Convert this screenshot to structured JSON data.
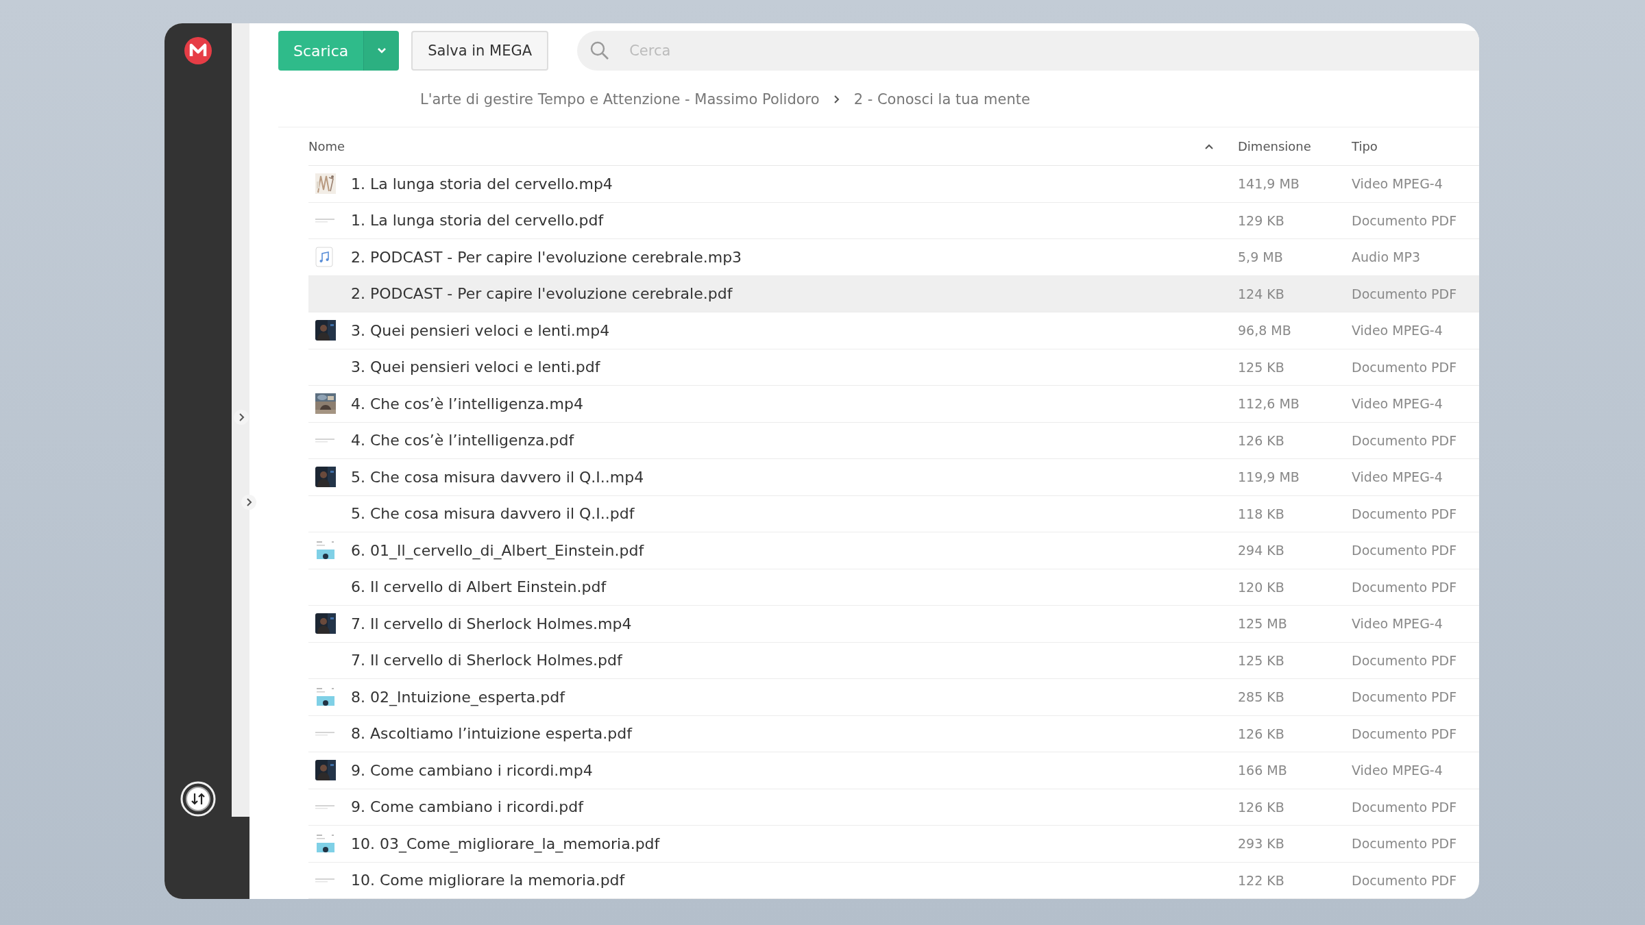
{
  "toolbar": {
    "download_button": "Scarica",
    "save_button": "Salva in MEGA",
    "search": {
      "placeholder": "Cerca"
    }
  },
  "breadcrumb": [
    "L'arte di gestire Tempo e Attenzione - Massimo Polidoro",
    "2 - Conosci la tua mente"
  ],
  "table": {
    "columns": [
      {
        "label": "Nome",
        "sorted": true
      },
      {
        "label": "Dimensione",
        "sorted": false
      },
      {
        "label": "Tipo",
        "sorted": false
      }
    ],
    "rows": [
      {
        "kind": "sketch",
        "name": "1. La lunga storia del cervello.mp4",
        "size": "141,9 MB",
        "type": "Video MPEG-4",
        "highlighted": false
      },
      {
        "kind": "page",
        "name": "1. La lunga storia del cervello.pdf",
        "size": "129 KB",
        "type": "Documento PDF",
        "highlighted": false
      },
      {
        "kind": "audio",
        "name": "2. PODCAST - Per capire l'evoluzione cerebrale.mp3",
        "size": "5,9 MB",
        "type": "Audio MP3",
        "highlighted": false
      },
      {
        "kind": "none",
        "name": "2. PODCAST - Per capire l'evoluzione cerebrale.pdf",
        "size": "124 KB",
        "type": "Documento PDF",
        "highlighted": true
      },
      {
        "kind": "video",
        "name": "3. Quei pensieri veloci e lenti.mp4",
        "size": "96,8 MB",
        "type": "Video MPEG-4",
        "highlighted": false
      },
      {
        "kind": "none",
        "name": "3. Quei pensieri veloci e lenti.pdf",
        "size": "125 KB",
        "type": "Documento PDF",
        "highlighted": false
      },
      {
        "kind": "room",
        "name": "4. Che cos’è l’intelligenza.mp4",
        "size": "112,6 MB",
        "type": "Video MPEG-4",
        "highlighted": false
      },
      {
        "kind": "page",
        "name": "4. Che cos’è l’intelligenza.pdf",
        "size": "126 KB",
        "type": "Documento PDF",
        "highlighted": false
      },
      {
        "kind": "video",
        "name": "5. Che cosa misura davvero il Q.I..mp4",
        "size": "119,9 MB",
        "type": "Video MPEG-4",
        "highlighted": false
      },
      {
        "kind": "none",
        "name": "5. Che cosa misura davvero il Q.I..pdf",
        "size": "118 KB",
        "type": "Documento PDF",
        "highlighted": false
      },
      {
        "kind": "cover",
        "name": "6. 01_Il_cervello_di_Albert_Einstein.pdf",
        "size": "294 KB",
        "type": "Documento PDF",
        "highlighted": false
      },
      {
        "kind": "none",
        "name": "6. Il cervello di Albert Einstein.pdf",
        "size": "120 KB",
        "type": "Documento PDF",
        "highlighted": false
      },
      {
        "kind": "video",
        "name": "7. Il cervello di Sherlock Holmes.mp4",
        "size": "125 MB",
        "type": "Video MPEG-4",
        "highlighted": false
      },
      {
        "kind": "none",
        "name": "7. Il cervello di Sherlock Holmes.pdf",
        "size": "125 KB",
        "type": "Documento PDF",
        "highlighted": false
      },
      {
        "kind": "cover",
        "name": "8. 02_Intuizione_esperta.pdf",
        "size": "285 KB",
        "type": "Documento PDF",
        "highlighted": false
      },
      {
        "kind": "page",
        "name": "8. Ascoltiamo l’intuizione esperta.pdf",
        "size": "126 KB",
        "type": "Documento PDF",
        "highlighted": false
      },
      {
        "kind": "video",
        "name": "9. Come cambiano i ricordi.mp4",
        "size": "166 MB",
        "type": "Video MPEG-4",
        "highlighted": false
      },
      {
        "kind": "page",
        "name": "9. Come cambiano i ricordi.pdf",
        "size": "126 KB",
        "type": "Documento PDF",
        "highlighted": false
      },
      {
        "kind": "cover",
        "name": "10. 03_Come_migliorare_la_memoria.pdf",
        "size": "293 KB",
        "type": "Documento PDF",
        "highlighted": false
      },
      {
        "kind": "page",
        "name": "10. Come migliorare la memoria.pdf",
        "size": "122 KB",
        "type": "Documento PDF",
        "highlighted": false
      }
    ]
  }
}
